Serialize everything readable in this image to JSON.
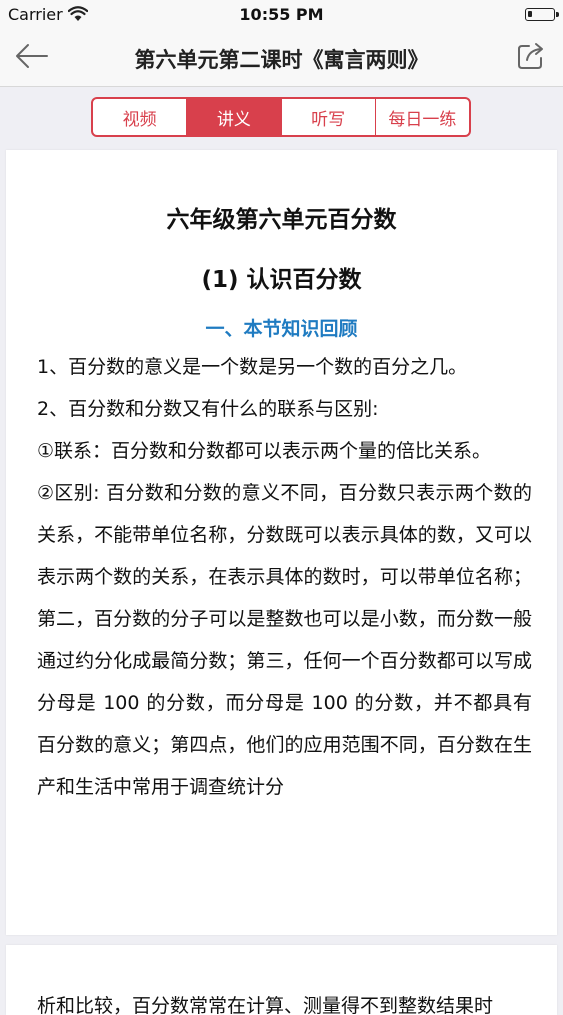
{
  "status_bar": {
    "carrier": "Carrier",
    "time": "10:55 PM"
  },
  "nav": {
    "title": "第六单元第二课时《寓言两则》",
    "back_icon": "back-arrow-icon",
    "share_icon": "share-icon"
  },
  "tabs": [
    {
      "label": "视频",
      "active": false
    },
    {
      "label": "讲义",
      "active": true
    },
    {
      "label": "听写",
      "active": false
    },
    {
      "label": "每日一练",
      "active": false
    }
  ],
  "accent_color": "#d8404c",
  "heading_color": "#1f7bc1",
  "document": {
    "title": "六年级第六单元百分数",
    "subtitle": "(1) 认识百分数",
    "section_heading": "一、本节知识回顾",
    "paragraphs": [
      "1、百分数的意义是一个数是另一个数的百分之几。",
      "2、百分数和分数又有什么的联系与区别:",
      "①联系：百分数和分数都可以表示两个量的倍比关系。",
      "②区别: 百分数和分数的意义不同，百分数只表示两个数的关系，不能带单位名称，分数既可以表示具体的数，又可以表示两个数的关系，在表示具体的数时，可以带单位名称；第二，百分数的分子可以是整数也可以是小数，而分数一般通过约分化成最简分数；第三，任何一个百分数都可以写成分母是 100 的分数，而分母是 100 的分数，并不都具有百分数的意义；第四点，他们的应用范围不同，百分数在生产和生活中常用于调查统计分"
    ],
    "next_page_text": "析和比较，百分数常常在计算、测量得不到整数结果时"
  }
}
